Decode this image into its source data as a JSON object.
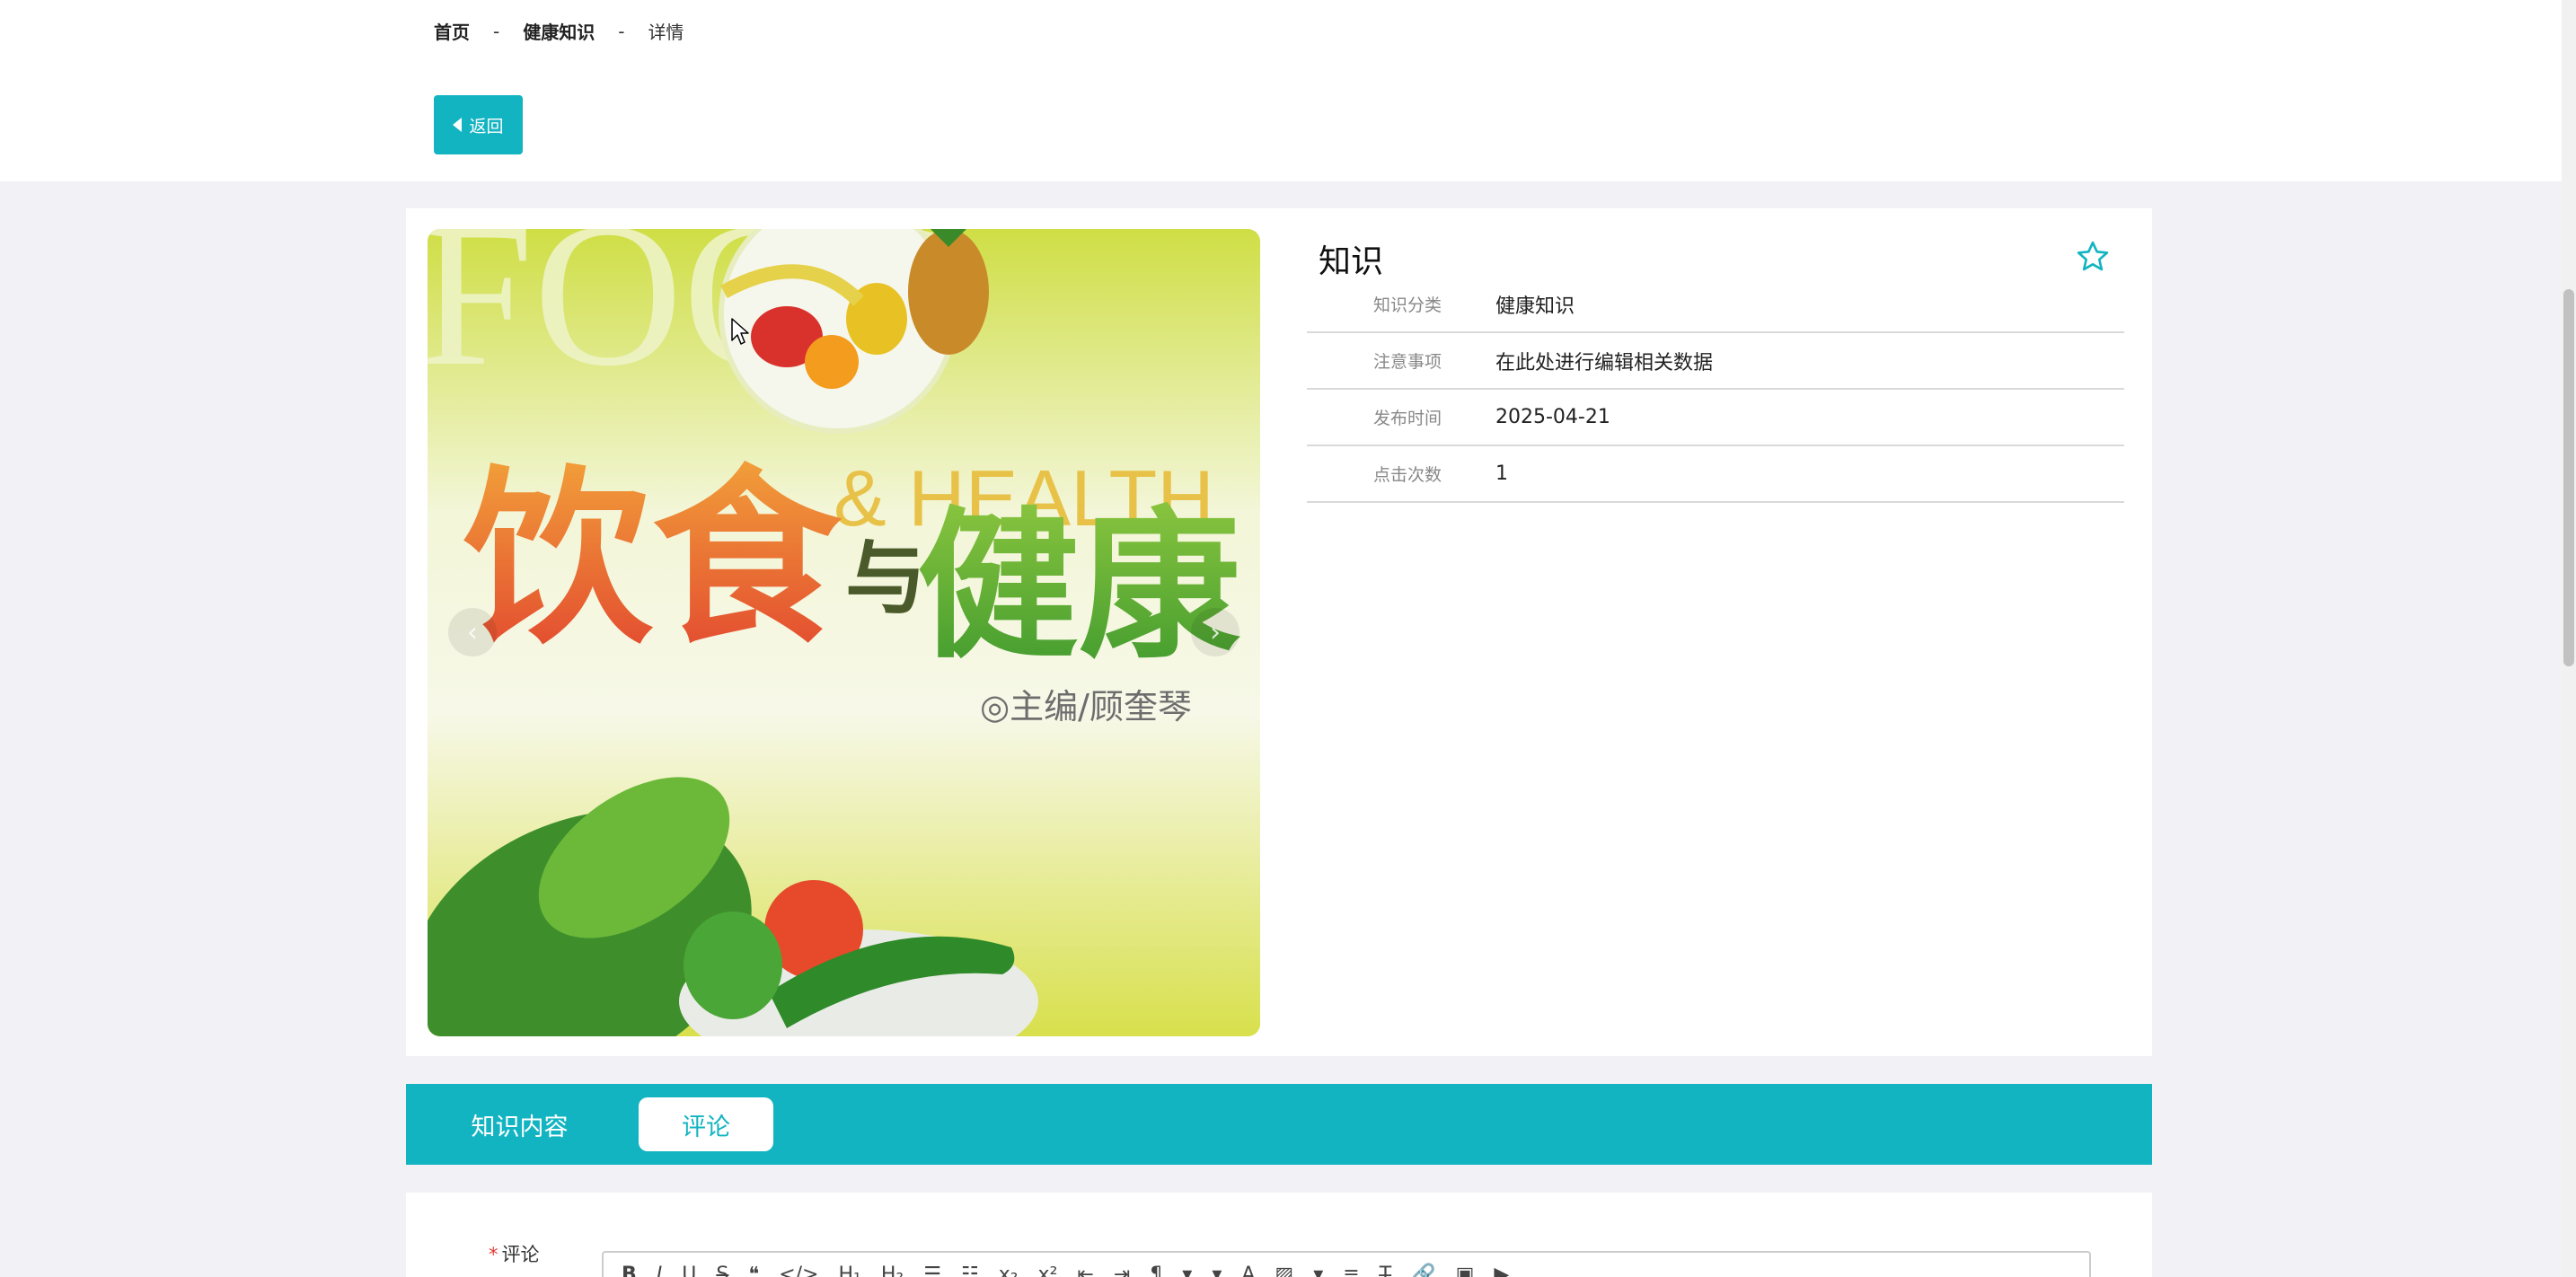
{
  "breadcrumb": {
    "home": "首页",
    "category": "健康知识",
    "current": "详情",
    "separator": "-"
  },
  "back_button": {
    "label": "返回"
  },
  "detail": {
    "title": "知识",
    "fields": [
      {
        "label": "知识分类",
        "value": "健康知识"
      },
      {
        "label": "注意事项",
        "value": "在此处进行编辑相关数据"
      },
      {
        "label": "发布时间",
        "value": "2025-04-21"
      },
      {
        "label": "点击次数",
        "value": "1"
      }
    ]
  },
  "cover_image": {
    "text_food": "FOOD",
    "text_health": "& HEALTH",
    "text_cn_1": "饮食",
    "text_cn_2": "与",
    "text_cn_3": "健康",
    "text_editor": "◎主编/顾奎琴"
  },
  "tabs": [
    {
      "label": "知识内容",
      "active": false
    },
    {
      "label": "评论",
      "active": true
    }
  ],
  "comment": {
    "label": "评论",
    "required_mark": "*"
  },
  "colors": {
    "accent": "#13b4c2",
    "star": "#13b4c2",
    "page_bg": "#f2f1f6"
  }
}
